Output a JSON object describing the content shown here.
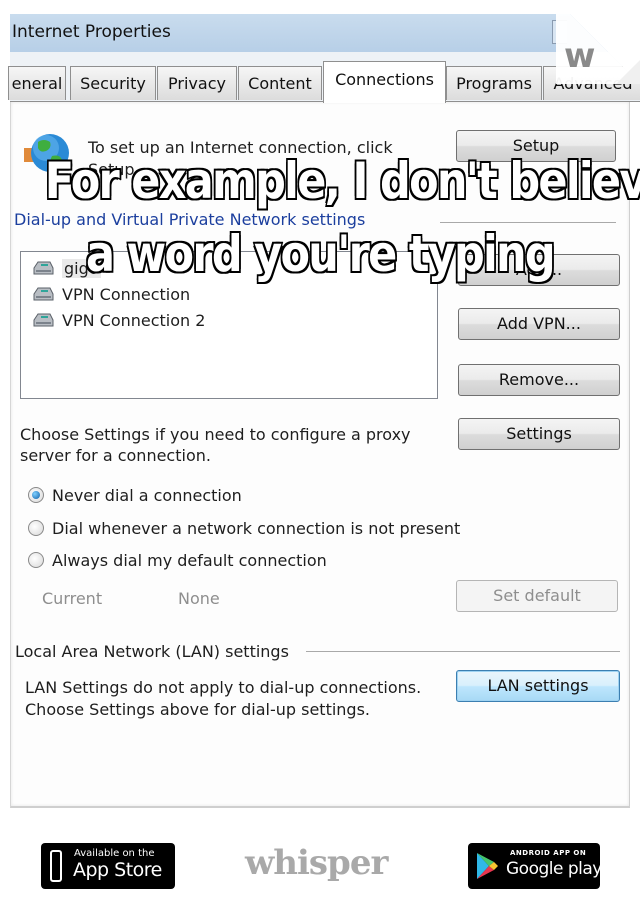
{
  "window": {
    "title": "Internet Properties"
  },
  "tabs": [
    {
      "label": "eneral",
      "active": false
    },
    {
      "label": "Security",
      "active": false
    },
    {
      "label": "Privacy",
      "active": false
    },
    {
      "label": "Content",
      "active": false
    },
    {
      "label": "Connections",
      "active": true
    },
    {
      "label": "Programs",
      "active": false
    },
    {
      "label": "Advanced",
      "active": false
    }
  ],
  "setup_section": {
    "text_line1": "To set up an Internet connection, click",
    "text_line2": "Setup.",
    "setup_button": "Setup"
  },
  "dialup_section": {
    "heading": "Dial-up and Virtual Private Network settings",
    "connections": [
      {
        "label": "gigo",
        "selected": true
      },
      {
        "label": "VPN Connection",
        "selected": false
      },
      {
        "label": "VPN Connection 2",
        "selected": false
      }
    ],
    "add_button": "Add...",
    "add_vpn_button": "Add VPN...",
    "remove_button": "Remove...",
    "proxy_text_line1": "Choose Settings if you need to configure a proxy",
    "proxy_text_line2": "server for a connection.",
    "settings_button": "Settings",
    "radio_options": [
      {
        "label": "Never dial a connection",
        "checked": true
      },
      {
        "label": "Dial whenever a network connection is not present",
        "checked": false
      },
      {
        "label": "Always dial my default connection",
        "checked": false
      }
    ],
    "current_label": "Current",
    "current_value": "None",
    "set_default_button": "Set default"
  },
  "lan_section": {
    "heading": "Local Area Network (LAN) settings",
    "text_line1": "LAN Settings do not apply to dial-up connections.",
    "text_line2": "Choose Settings above for dial-up settings.",
    "lan_button": "LAN settings"
  },
  "overlay": {
    "caption_line1": "For example, I don't believe",
    "caption_line2": "a word you're typing",
    "corner_badge": "w"
  },
  "footer": {
    "app_store_small": "Available on the",
    "app_store_big": "App Store",
    "brand": "whisper",
    "google_small": "ANDROID APP ON",
    "google_big": "Google play"
  },
  "colors": {
    "title_bar": "#b7cfe7",
    "section_heading": "#1c3f9e",
    "focus_button": "#bee6fd",
    "brand_gray": "#a9a9a9"
  }
}
